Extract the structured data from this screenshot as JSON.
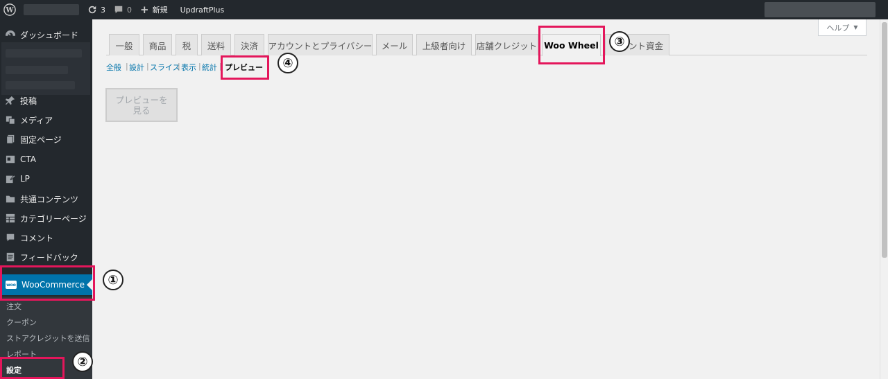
{
  "adminbar": {
    "updates_count": "3",
    "comments_count": "0",
    "new_label": "新規",
    "updraft_label": "UpdraftPlus"
  },
  "sidebar": {
    "dashboard": "ダッシュボード",
    "posts": "投稿",
    "media": "メディア",
    "pages": "固定ページ",
    "cta": "CTA",
    "lp": "LP",
    "common": "共通コンテンツ",
    "category_pages": "カテゴリーページ",
    "comments": "コメント",
    "feedback": "フィードバック",
    "woocommerce": "WooCommerce",
    "woo_logo_text": "woo",
    "submenu": [
      "注文",
      "クーポン",
      "ストアクレジットを送信",
      "レポート",
      "設定"
    ]
  },
  "help": {
    "label": "ヘルプ",
    "arrow": "▼"
  },
  "tabs": [
    "一般",
    "商品",
    "税",
    "送料",
    "決済",
    "アカウントとプライバシー",
    "メール",
    "上級者向け",
    "店舗クレジット",
    "Woo Wheel",
    "ント資金"
  ],
  "subnav": {
    "items": [
      "全般",
      "設計",
      "スライス",
      "表示",
      "統計"
    ],
    "separator": "|",
    "current": "プレビュー"
  },
  "preview_button": {
    "line1": "プレビューを",
    "line2": "見る"
  },
  "annotations": [
    "①",
    "②",
    "③",
    "④"
  ],
  "colors": {
    "highlight": "#e4165b",
    "woo_blue": "#0073aa",
    "sidebar_bg": "#23282d"
  }
}
